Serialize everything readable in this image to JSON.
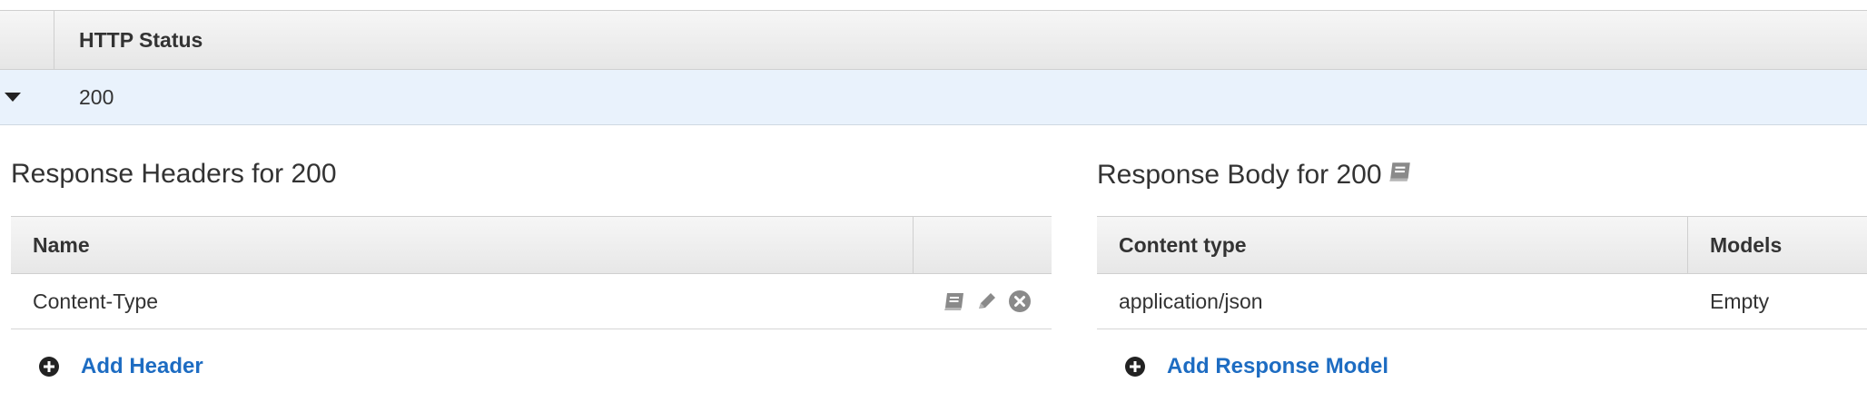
{
  "status_table": {
    "column_label": "HTTP Status",
    "row_code": "200"
  },
  "headers_section": {
    "title": "Response Headers for 200",
    "columns": {
      "name": "Name",
      "actions": ""
    },
    "rows": [
      {
        "name": "Content-Type"
      }
    ],
    "add_label": "Add Header"
  },
  "body_section": {
    "title": "Response Body for 200",
    "columns": {
      "content_type": "Content type",
      "models": "Models"
    },
    "rows": [
      {
        "content_type": "application/json",
        "model": "Empty"
      }
    ],
    "add_label": "Add Response Model"
  },
  "icons": {
    "expand": "caret-down-icon",
    "docs": "book-icon",
    "edit": "pencil-icon",
    "remove": "remove-circle-icon",
    "add": "plus-circle-icon"
  },
  "colors": {
    "link": "#1d6cc2",
    "selected_row": "#e9f2fc",
    "icon_gray": "#8a8a8a"
  }
}
